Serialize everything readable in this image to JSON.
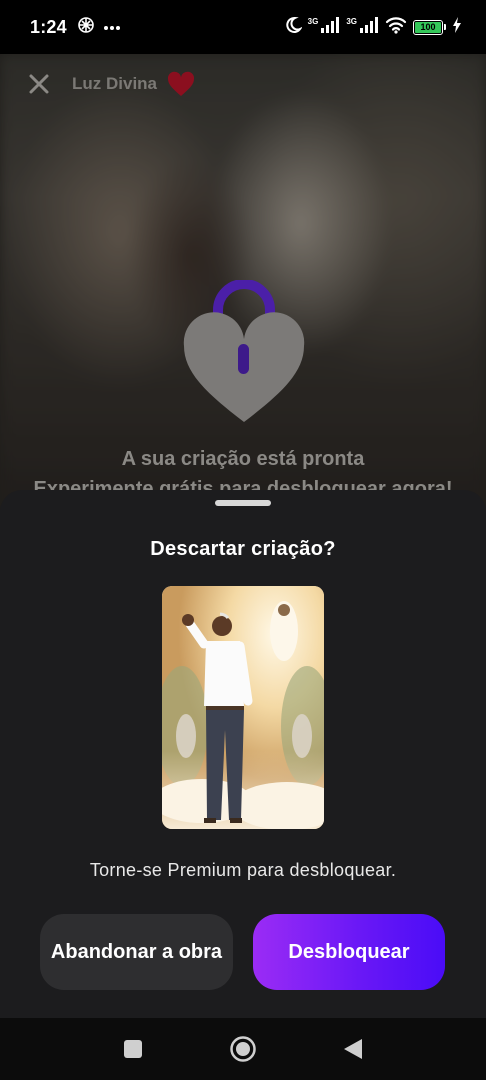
{
  "status_bar": {
    "time": "1:24",
    "network_label_1": "3G",
    "network_label_2": "3G",
    "battery_level": "100",
    "icons": [
      "app-icon",
      "more-icon",
      "moon-icon",
      "signal-icon",
      "signal-icon",
      "wifi-icon",
      "battery-icon",
      "charging-icon"
    ]
  },
  "header": {
    "app_name": "Luz Divina",
    "close_icon": "close-icon",
    "heart_icon": "heart-icon",
    "heart_color": "#8b0f1f"
  },
  "locked_overlay": {
    "title": "A sua criação está pronta",
    "subtitle": "Experimente grátis para desbloquear agora!",
    "lock_icon": "heart-lock-icon",
    "lock_shackle_color": "#4b1fa8"
  },
  "sheet": {
    "title": "Descartar criação?",
    "message": "Torne-se Premium para desbloquear.",
    "abandon_label": "Abandonar a obra",
    "unlock_label": "Desbloquear",
    "accent_gradient": [
      "#9b2cf5",
      "#4a0cf7"
    ]
  },
  "nav_bar": {
    "icons": [
      "recents-square-icon",
      "home-circle-icon",
      "back-triangle-icon"
    ]
  }
}
